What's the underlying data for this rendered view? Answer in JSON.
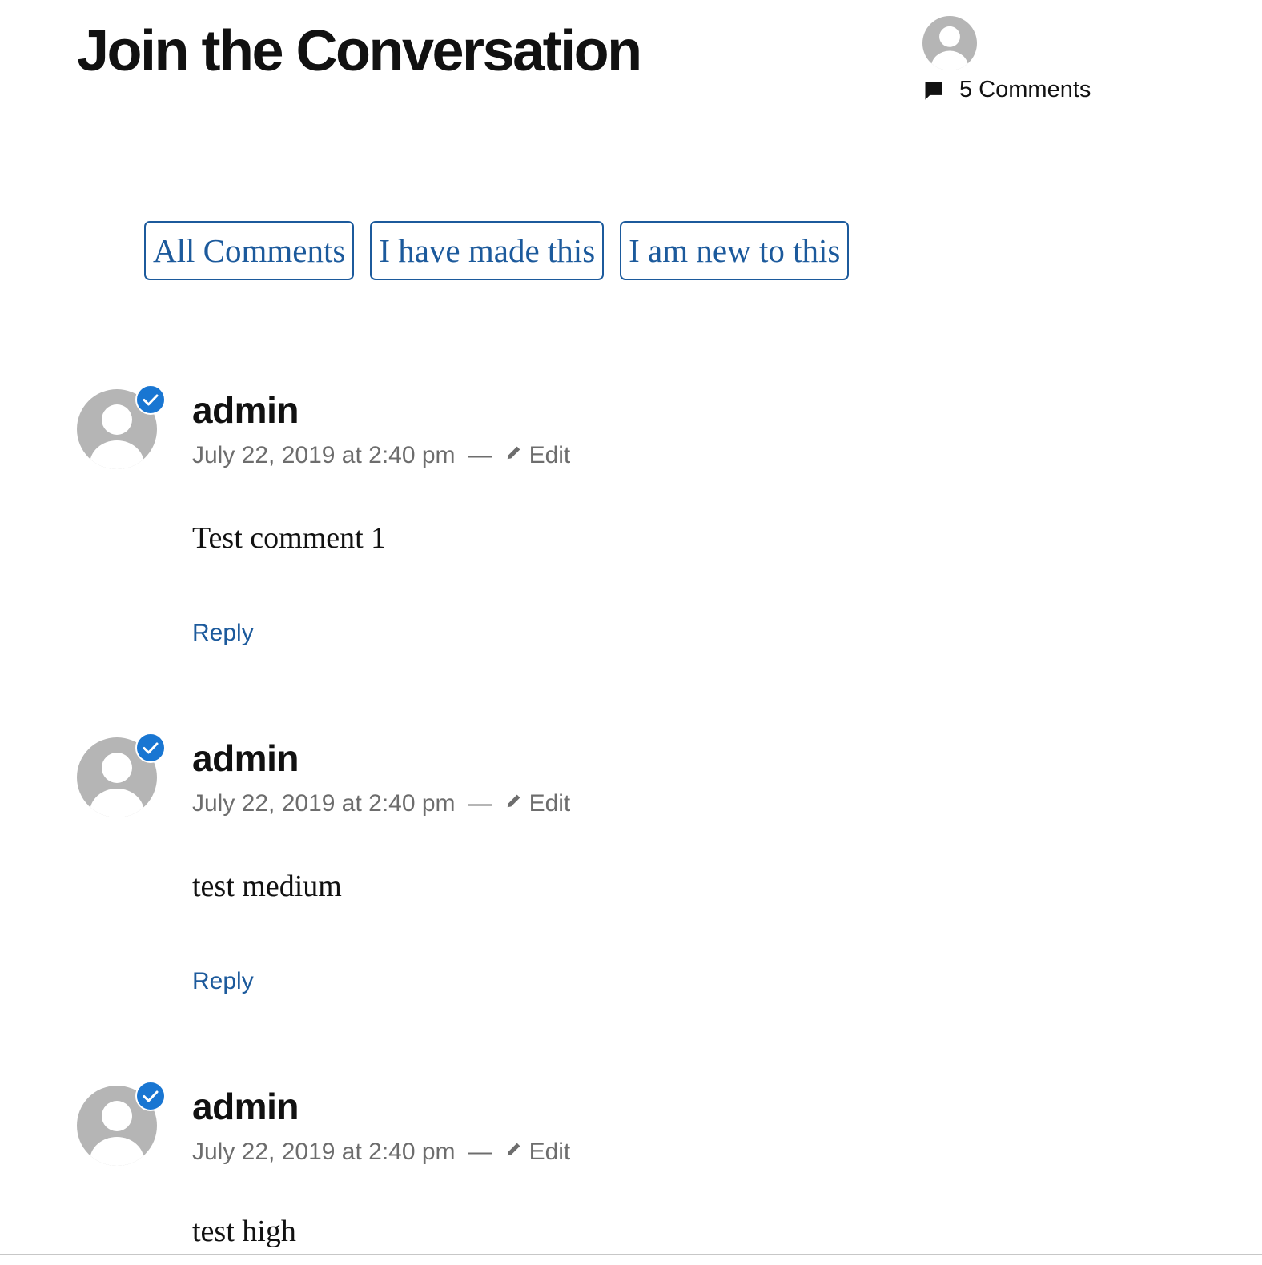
{
  "header": {
    "title": "Join the Conversation",
    "avatar_icon": "user-avatar-icon",
    "comment_count_icon": "comment-bubble-icon",
    "comment_count_label": "5 Comments"
  },
  "filters": [
    {
      "label": "All Comments"
    },
    {
      "label": "I have made this"
    },
    {
      "label": "I am new to this"
    }
  ],
  "comments": [
    {
      "author": "admin",
      "date": "July 22, 2019 at 2:40 pm",
      "separator": "—",
      "edit_label": "Edit",
      "body": "Test comment 1",
      "reply_label": "Reply",
      "verified": true
    },
    {
      "author": "admin",
      "date": "July 22, 2019 at 2:40 pm",
      "separator": "—",
      "edit_label": "Edit",
      "body": "test medium",
      "reply_label": "Reply",
      "verified": true
    },
    {
      "author": "admin",
      "date": "July 22, 2019 at 2:40 pm",
      "separator": "—",
      "edit_label": "Edit",
      "body": "test high",
      "verified": true
    }
  ],
  "colors": {
    "accent": "#1c5a9c",
    "verified_badge": "#1976d2",
    "meta_text": "#6d6d6d",
    "avatar_gray": "#b5b5b5"
  }
}
